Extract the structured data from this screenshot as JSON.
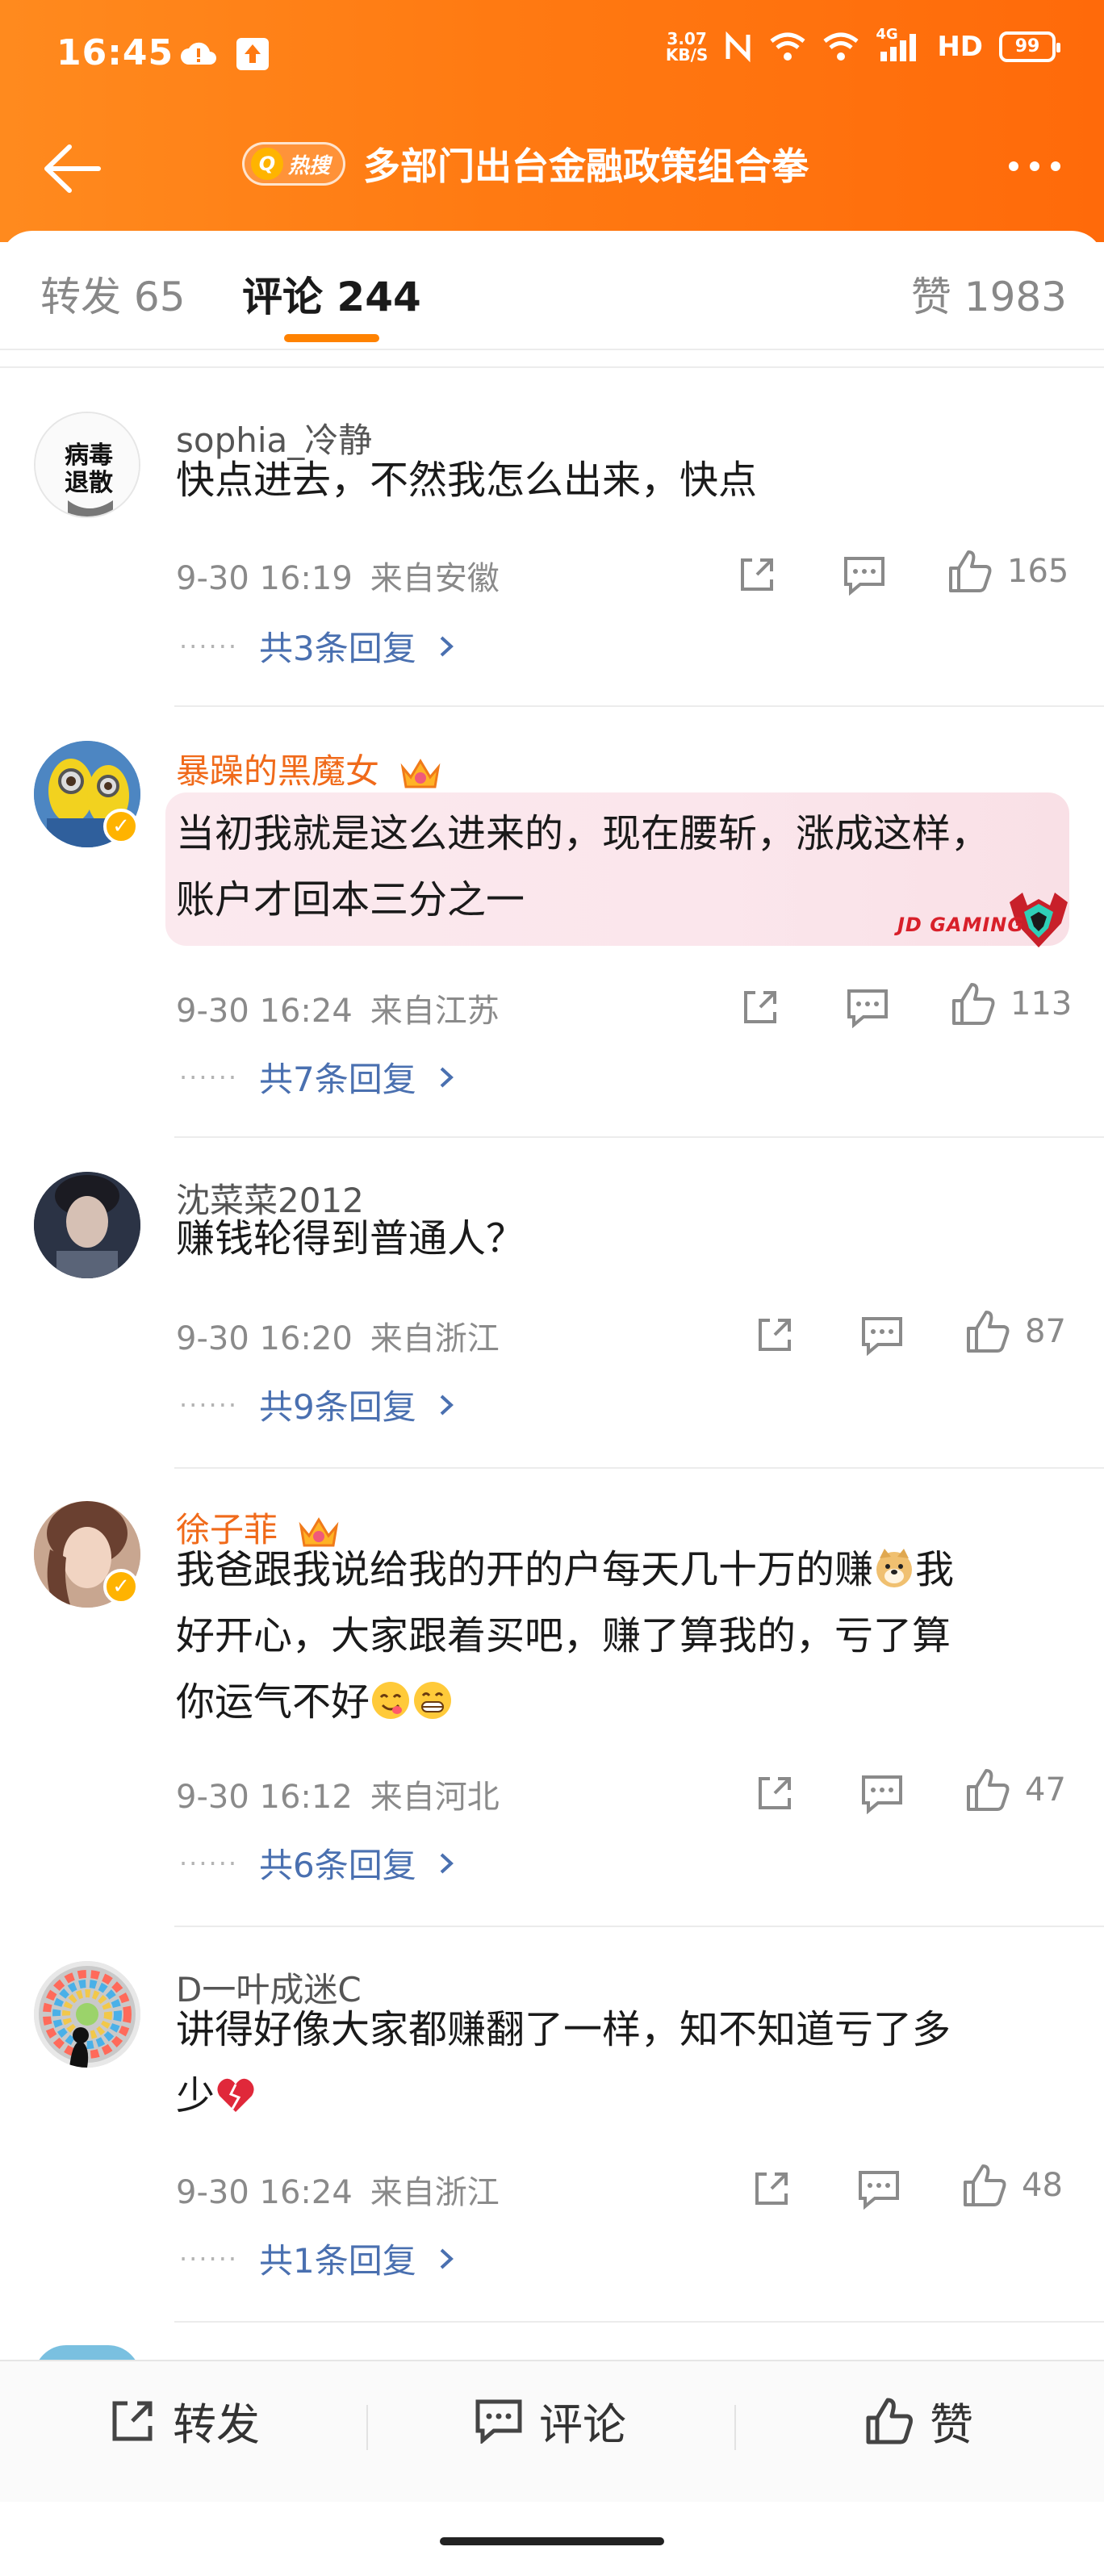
{
  "status_bar": {
    "time": "16:45",
    "net_speed_value": "3.07",
    "net_speed_unit": "KB/S",
    "signal": "4G",
    "hd": "HD",
    "battery": "99"
  },
  "nav": {
    "hot_tag": "热搜",
    "title": "多部门出台金融政策组合拳"
  },
  "tabs": {
    "repost": "转发 65",
    "comments": "评论 244",
    "likes": "赞 1983"
  },
  "comments": [
    {
      "user": "sophia_冷静",
      "text": "快点进去，不然我怎么出来，快点",
      "time": "9-30 16:19",
      "source": "来自安徽",
      "likes": "165",
      "replies": "共3条回复",
      "avatar_text": "病毒退散"
    },
    {
      "user": "暴躁的黑魔女",
      "text": "当初我就是这么进来的，现在腰斩，涨成这样，账户才回本三分之一",
      "time": "9-30 16:24",
      "source": "来自江苏",
      "likes": "113",
      "replies": "共7条回复",
      "bubble_brand": "JD GAMING",
      "vip": true
    },
    {
      "user": "沈菜菜2012",
      "text": "赚钱轮得到普通人？",
      "time": "9-30 16:20",
      "source": "来自浙江",
      "likes": "87",
      "replies": "共9条回复"
    },
    {
      "user": "徐子菲",
      "text_line1": "我爸跟我说给我的开的户每天几十万的赚",
      "text_line1_tail": "我",
      "text_line2": "好开心，大家跟着买吧，赚了算我的，亏了算",
      "text_line3": "你运气不好",
      "time": "9-30 16:12",
      "source": "来自河北",
      "likes": "47",
      "replies": "共6条回复",
      "vip": true
    },
    {
      "user": "D一叶成迷C",
      "text_line1": "讲得好像大家都赚翻了一样，知不知道亏了多",
      "text_line2": "少",
      "time": "9-30 16:24",
      "source": "来自浙江",
      "likes": "48",
      "replies": "共1条回复"
    }
  ],
  "bottom_bar": {
    "repost": "转发",
    "comment": "评论",
    "like": "赞"
  },
  "colors": {
    "accent": "#ff8200",
    "link": "#4a70b0",
    "vip_name": "#f06a1a"
  }
}
